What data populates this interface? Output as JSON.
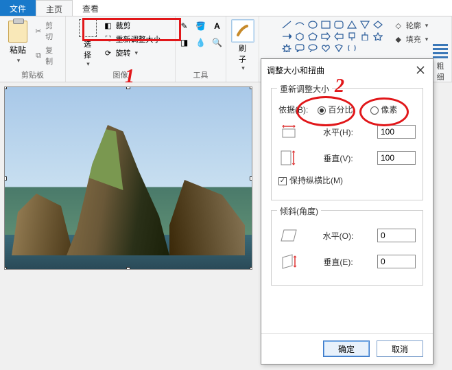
{
  "tabs": {
    "file": "文件",
    "home": "主页",
    "view": "查看"
  },
  "clipboard": {
    "paste": "粘贴",
    "cut": "剪切",
    "copy": "复制",
    "group": "剪贴板"
  },
  "image": {
    "select": "选\n择",
    "crop": "裁剪",
    "resize": "重新调整大小",
    "rotate": "旋转",
    "group": "图像"
  },
  "tools": {
    "group": "工具"
  },
  "brush": {
    "label": "刷\n子"
  },
  "shapes": {
    "outline": "轮廓",
    "fill": "填充",
    "thick": "粗\n细"
  },
  "annotations": {
    "one": "1",
    "two": "2"
  },
  "dialog": {
    "title": "调整大小和扭曲",
    "resize_legend": "重新调整大小",
    "by_label": "依据(B):",
    "percent": "百分比",
    "pixels": "像素",
    "horiz": "水平(H):",
    "vert": "垂直(V):",
    "h_val": "100",
    "v_val": "100",
    "aspect": "保持纵横比(M)",
    "skew_legend": "倾斜(角度)",
    "skew_h": "水平(O):",
    "skew_v": "垂直(E):",
    "sh_val": "0",
    "sv_val": "0",
    "ok": "确定",
    "cancel": "取消"
  }
}
